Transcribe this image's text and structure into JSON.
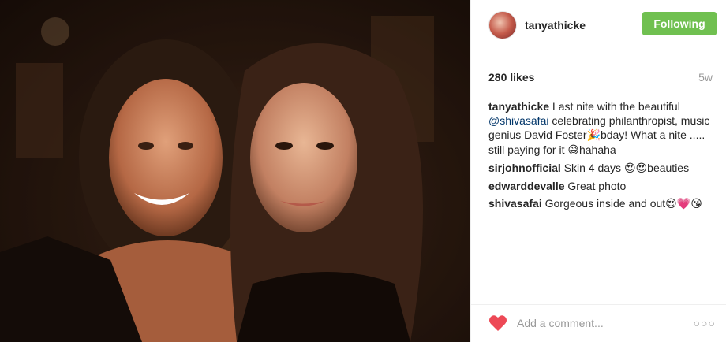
{
  "photo": {
    "alt": "Selfie of two women at night"
  },
  "header": {
    "username": "tanyathicke",
    "follow_label": "Following"
  },
  "stats": {
    "likes": "280 likes",
    "time": "5w"
  },
  "caption": {
    "author": "tanyathicke",
    "text_1": "Last nite with the beautiful ",
    "mention": "@shivasafai",
    "text_2": " celebrating philanthropist, music genius David Foster",
    "emoji_1": "🎉",
    "text_3": "bday! What a nite ..... still paying for it ",
    "emoji_2": "😅",
    "text_4": "hahaha"
  },
  "comments": [
    {
      "author": "sirjohnofficial",
      "text": "Skin 4 days ",
      "emoji": "😍😍",
      "text_after": "beauties"
    },
    {
      "author": "edwarddevalle",
      "text": "Great photo",
      "emoji": "",
      "text_after": ""
    },
    {
      "author": "shivasafai",
      "text": "Gorgeous inside and out",
      "emoji": "😍💗😘",
      "text_after": ""
    }
  ],
  "footer": {
    "comment_placeholder": "Add a comment...",
    "more_label": "○○○",
    "like_icon": "heart-icon",
    "like_color": "#ed4956"
  },
  "colors": {
    "follow_button": "#70c050",
    "mention": "#003569"
  }
}
